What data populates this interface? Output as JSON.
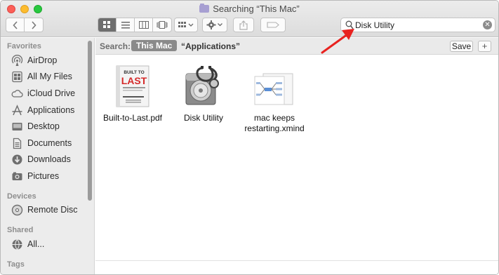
{
  "window": {
    "title": "Searching “This Mac”"
  },
  "toolbar": {
    "search_value": "Disk Utility",
    "icons": [
      "chevron-left-icon",
      "chevron-right-icon",
      "icon-view-icon",
      "list-view-icon",
      "column-view-icon",
      "cover-flow-icon",
      "group-icon",
      "gear-icon",
      "share-icon",
      "tag-icon",
      "search-icon",
      "clear-icon"
    ]
  },
  "sidebar": {
    "favorites_header": "Favorites",
    "favorites": [
      {
        "label": "AirDrop",
        "icon": "airdrop-icon"
      },
      {
        "label": "All My Files",
        "icon": "all-files-icon"
      },
      {
        "label": "iCloud Drive",
        "icon": "cloud-icon"
      },
      {
        "label": "Applications",
        "icon": "applications-icon"
      },
      {
        "label": "Desktop",
        "icon": "desktop-icon"
      },
      {
        "label": "Documents",
        "icon": "documents-icon"
      },
      {
        "label": "Downloads",
        "icon": "downloads-icon"
      },
      {
        "label": "Pictures",
        "icon": "pictures-icon"
      }
    ],
    "devices_header": "Devices",
    "devices": [
      {
        "label": "Remote Disc",
        "icon": "disc-icon"
      }
    ],
    "shared_header": "Shared",
    "shared": [
      {
        "label": "All...",
        "icon": "network-icon"
      }
    ],
    "tags_header": "Tags"
  },
  "scope": {
    "label": "Search:",
    "active": "This Mac",
    "other": "“Applications”",
    "save": "Save",
    "plus": "+"
  },
  "files": [
    {
      "name": "Built-to-Last.pdf",
      "icon": "pdf-book-icon",
      "cover_line1": "BUILT TO",
      "cover_line2": "LAST"
    },
    {
      "name": "Disk Utility",
      "icon": "disk-utility-icon"
    },
    {
      "name_line1": "mac keeps",
      "name_line2": "restarting.xmind",
      "icon": "xmind-file-icon"
    }
  ],
  "colors": {
    "annotation": "#e8221f",
    "scope_active": "#8a8a8a",
    "sidebar_bg": "#ececec"
  }
}
